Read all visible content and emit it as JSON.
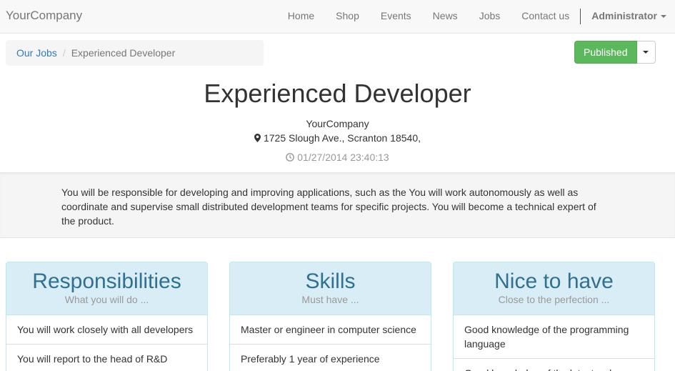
{
  "navbar": {
    "brand": "YourCompany",
    "items": [
      "Home",
      "Shop",
      "Events",
      "News",
      "Jobs",
      "Contact us"
    ],
    "user": "Administrator"
  },
  "breadcrumb": {
    "link": "Our Jobs",
    "separator": "/",
    "active": "Experienced Developer"
  },
  "publish": {
    "label": "Published",
    "color": "#5cb85c"
  },
  "job": {
    "title": "Experienced Developer",
    "company": "YourCompany",
    "address": "1725 Slough Ave., Scranton 18540,",
    "date": "01/27/2014 23:40:13",
    "description": "You will be responsible for developing and improving applications, such as the You will work autonomously as well as coordinate and supervise small distributed development teams for specific projects. You will become a technical expert of the product."
  },
  "panels": [
    {
      "title": "Responsibilities",
      "subtitle": "What you will do ...",
      "items": [
        "You will work closely with all developers",
        "You will report to the head of R&D"
      ]
    },
    {
      "title": "Skills",
      "subtitle": "Must have ...",
      "items": [
        "Master or engineer in computer science",
        "Preferably 1 year of experience"
      ]
    },
    {
      "title": "Nice to have",
      "subtitle": "Close to the perfection ...",
      "items": [
        "Good knowledge of the programming language",
        "Good knowledge of the latest web"
      ]
    }
  ],
  "colors": {
    "link": "#337ab7",
    "panel_heading": "#31708f",
    "panel_bg": "#d9edf7"
  }
}
